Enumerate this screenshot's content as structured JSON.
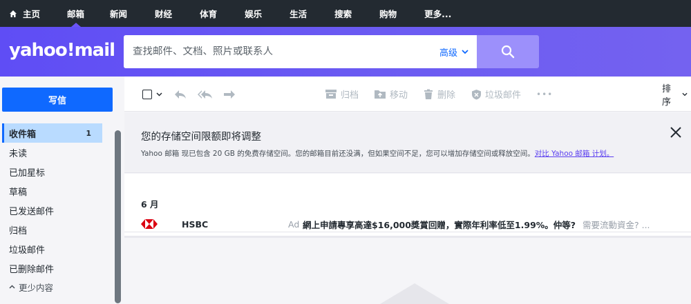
{
  "nav": {
    "home": "主页",
    "items": [
      "邮箱",
      "新闻",
      "财经",
      "体育",
      "娱乐",
      "生活",
      "搜索",
      "购物",
      "更多..."
    ]
  },
  "header": {
    "logo": "yahoo!mail",
    "search_placeholder": "查找邮件、文档、照片或联系人",
    "advanced": "高级"
  },
  "sidebar": {
    "compose": "写信",
    "folders": [
      {
        "label": "收件箱",
        "count": "1"
      },
      {
        "label": "未读"
      },
      {
        "label": "已加星标"
      },
      {
        "label": "草稿"
      },
      {
        "label": "已发送邮件"
      },
      {
        "label": "归档"
      },
      {
        "label": "垃圾邮件"
      },
      {
        "label": "已删除邮件"
      }
    ],
    "less": "更少内容"
  },
  "toolbar": {
    "archive": "归档",
    "move": "移动",
    "delete": "删除",
    "spam": "垃圾邮件",
    "more": "•••",
    "sort": "排序"
  },
  "notice": {
    "title": "您的存储空间限额即将调整",
    "body": "Yahoo 邮箱 现已包含 20 GB 的免费存储空间。您的邮箱目前还没满，但如果空间不足，您可以增加存储空间或释放空间。",
    "link": "对比 Yahoo 邮箱 计划。"
  },
  "messages": {
    "month": "6 月",
    "items": [
      {
        "sender": "HSBC",
        "ad": "Ad",
        "subject": "網上申請專享高達$16,000獎賞回贈，實際年利率低至1.99%。仲等?",
        "snippet": "需要流動資金? ..."
      }
    ]
  },
  "colors": {
    "accent": "#6a54f6",
    "compose": "#0f69ff",
    "nav_bg": "#232a31",
    "active_folder": "#b9dbff"
  }
}
